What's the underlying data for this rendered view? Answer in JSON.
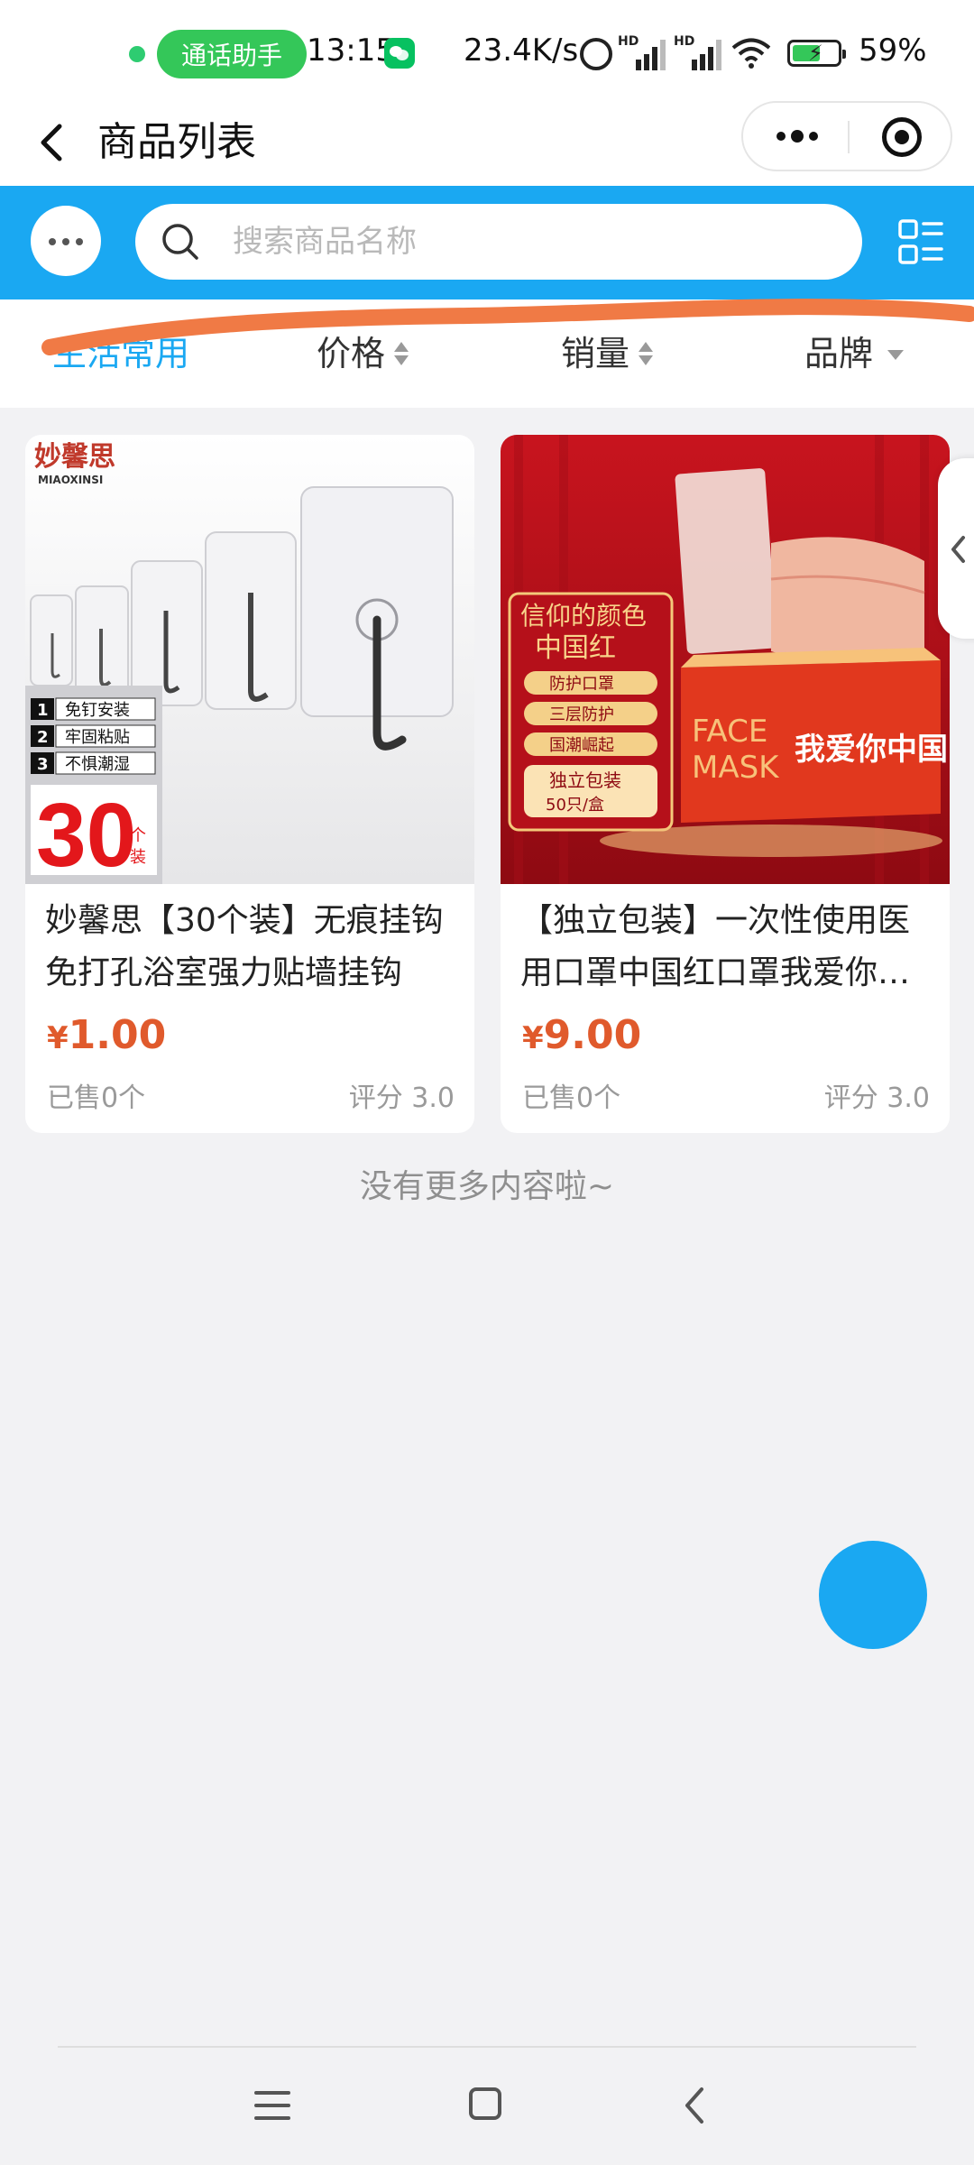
{
  "status_bar": {
    "call_assistant": "通话助手",
    "time": "13:15",
    "network_speed": "23.4K/s",
    "signal_1_label": "HD",
    "signal_2_label": "HD",
    "battery": "59%"
  },
  "nav": {
    "title": "商品列表"
  },
  "search": {
    "placeholder": "搜索商品名称"
  },
  "filters": [
    {
      "label": "生活常用",
      "active": true
    },
    {
      "label": "价格"
    },
    {
      "label": "销量"
    },
    {
      "label": "品牌"
    }
  ],
  "products": [
    {
      "title": "妙馨思【30个装】无痕挂钩免打孔浴室强力贴墙挂钩",
      "currency": "¥",
      "price": "1.00",
      "sold": "已售0个",
      "rating": "评分 3.0",
      "image": {
        "brand": "妙馨思",
        "brand_en": "MIAOXINSI",
        "features": [
          "免钉安装",
          "牢固粘贴",
          "不惧潮湿"
        ],
        "feature_nums": [
          "1",
          "2",
          "3"
        ],
        "count": "30",
        "count_unit_1": "个",
        "count_unit_2": "装"
      }
    },
    {
      "title": "【独立包装】一次性使用医用口罩中国红口罩我爱你中国",
      "currency": "¥",
      "price": "9.00",
      "sold": "已售0个",
      "rating": "评分 3.0",
      "image": {
        "slogan_1": "信仰的颜色",
        "slogan_2": "中国红",
        "features": [
          "防护口罩",
          "三层防护",
          "国潮崛起",
          "独立包装"
        ],
        "pack": "50只/盒",
        "box_text_1": "FACE",
        "box_text_2": "MASK",
        "box_script": "我爱你中国"
      }
    }
  ],
  "footer": {
    "no_more": "没有更多内容啦~"
  },
  "colors": {
    "accent": "#1aa8f2",
    "price": "#e05a2c",
    "scribble": "#f07a45"
  }
}
